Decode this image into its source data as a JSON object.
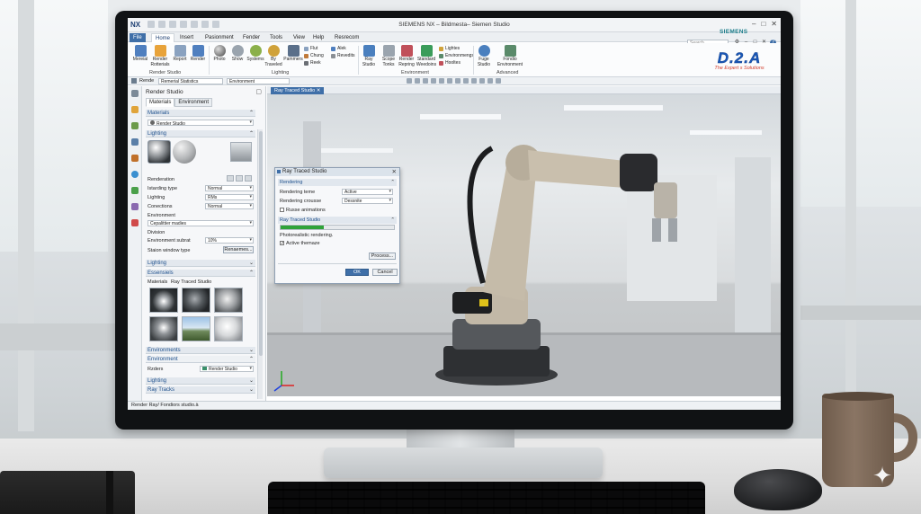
{
  "window": {
    "logo": "NX",
    "title": "SIEMENS NX – Bildmesta– Siemen Studio",
    "brand": "SIEMENS",
    "search_placeholder": "Search"
  },
  "ribbon_tabs": [
    "File",
    "Home",
    "Insert",
    "Pasionment",
    "Fender",
    "Tools",
    "View",
    "Help",
    "Resrecom"
  ],
  "ribbon": {
    "buttons": [
      {
        "label": "Mereial",
        "color": "#4f7fbf"
      },
      {
        "label": "Render Rotterials",
        "color": "#e8a33a"
      },
      {
        "label": "Report",
        "color": "#8aa2c0"
      },
      {
        "label": "Render",
        "color": "#4f7fbf"
      },
      {
        "label": "Photo",
        "color": "#6b6f75"
      },
      {
        "label": "Show",
        "color": "#9aa4ae"
      },
      {
        "label": "Systems",
        "color": "#8bb04a"
      },
      {
        "label": "By Traveled",
        "color": "#d0a23a"
      },
      {
        "label": "Pammers",
        "color": "#5a6f8a"
      }
    ],
    "small_items_1": [
      "Flut",
      "Chung",
      "Reek"
    ],
    "small_items_2": [
      "Alek",
      "Revedits"
    ],
    "buttons_2": [
      {
        "label": "Ray Studio",
        "color": "#4a7fbe"
      },
      {
        "label": "Scope Tonks",
        "color": "#9aa4ae"
      },
      {
        "label": "Render Repring",
        "color": "#c0505a"
      },
      {
        "label": "Standard Weedoins",
        "color": "#3a9c5a"
      }
    ],
    "small_items_3": [
      "Lightes",
      "Environmengs",
      "Hooltes"
    ],
    "buttons_3": [
      {
        "label": "Fuge Studio",
        "color": "#4a7fbe"
      },
      {
        "label": "Fondio Environment",
        "color": "#5a8a6a"
      }
    ],
    "group_labels": [
      "Render Studio",
      "Lighting",
      "Environment",
      "Advanced"
    ]
  },
  "toolbar": {
    "render_label": "Rende",
    "material_select": "Remerial Statistics",
    "env_select": "Environment"
  },
  "logo_d2a": {
    "mark": "D.2.A",
    "tagline": "The Expert s Solutions"
  },
  "panel": {
    "title": "Render Studio",
    "tabs": [
      "Materials",
      "Environment"
    ],
    "materials_section": "Materials",
    "materials_select": "Render Studio",
    "lighting_section": "Lighting",
    "renderation_label": "Renderation",
    "rows": [
      {
        "label": "Istarding type",
        "value": "Normal"
      },
      {
        "label": "Lighting",
        "value": "RMs"
      },
      {
        "label": "Conections",
        "value": "Normal"
      }
    ],
    "environment_label": "Environment",
    "environment_value": "Cepalittier madies",
    "division_label": "Division",
    "env_subst_label": "Environment subrat",
    "env_subst_value": "10%",
    "station_label": "Staion window type",
    "station_button": "Renaemes...",
    "lighting_section_2": "Lighting",
    "essensiels_section": "Essensiels",
    "mini_tabs": [
      "Materials",
      "Ray Traced Studio"
    ],
    "environments_section": "Environments",
    "environment_section_2": "Environment",
    "render_label": "Rzders",
    "render_value": "Render Studio",
    "lighting_section_3": "Lighting",
    "raytracks_section": "Ray Tracks"
  },
  "viewport": {
    "tab": "Ray Traced Studio"
  },
  "dialog": {
    "title": "Ray Traced Studio",
    "rendering_section": "Rendering",
    "rows": [
      {
        "label": "Rendering teme",
        "value": "Active"
      },
      {
        "label": "Rendering crousse",
        "value": "Dessnite"
      }
    ],
    "russe_label": "Russe animations",
    "rt_section": "Ray Traced Studio",
    "progress": 0.38,
    "status_text": "Photorealistic rendering.",
    "active_label": "Active themaze",
    "process_button": "Process...",
    "ok_button": "OK",
    "cancel_button": "Cancel"
  },
  "status_bar": "Render Ray/ Fondiors studio.à"
}
